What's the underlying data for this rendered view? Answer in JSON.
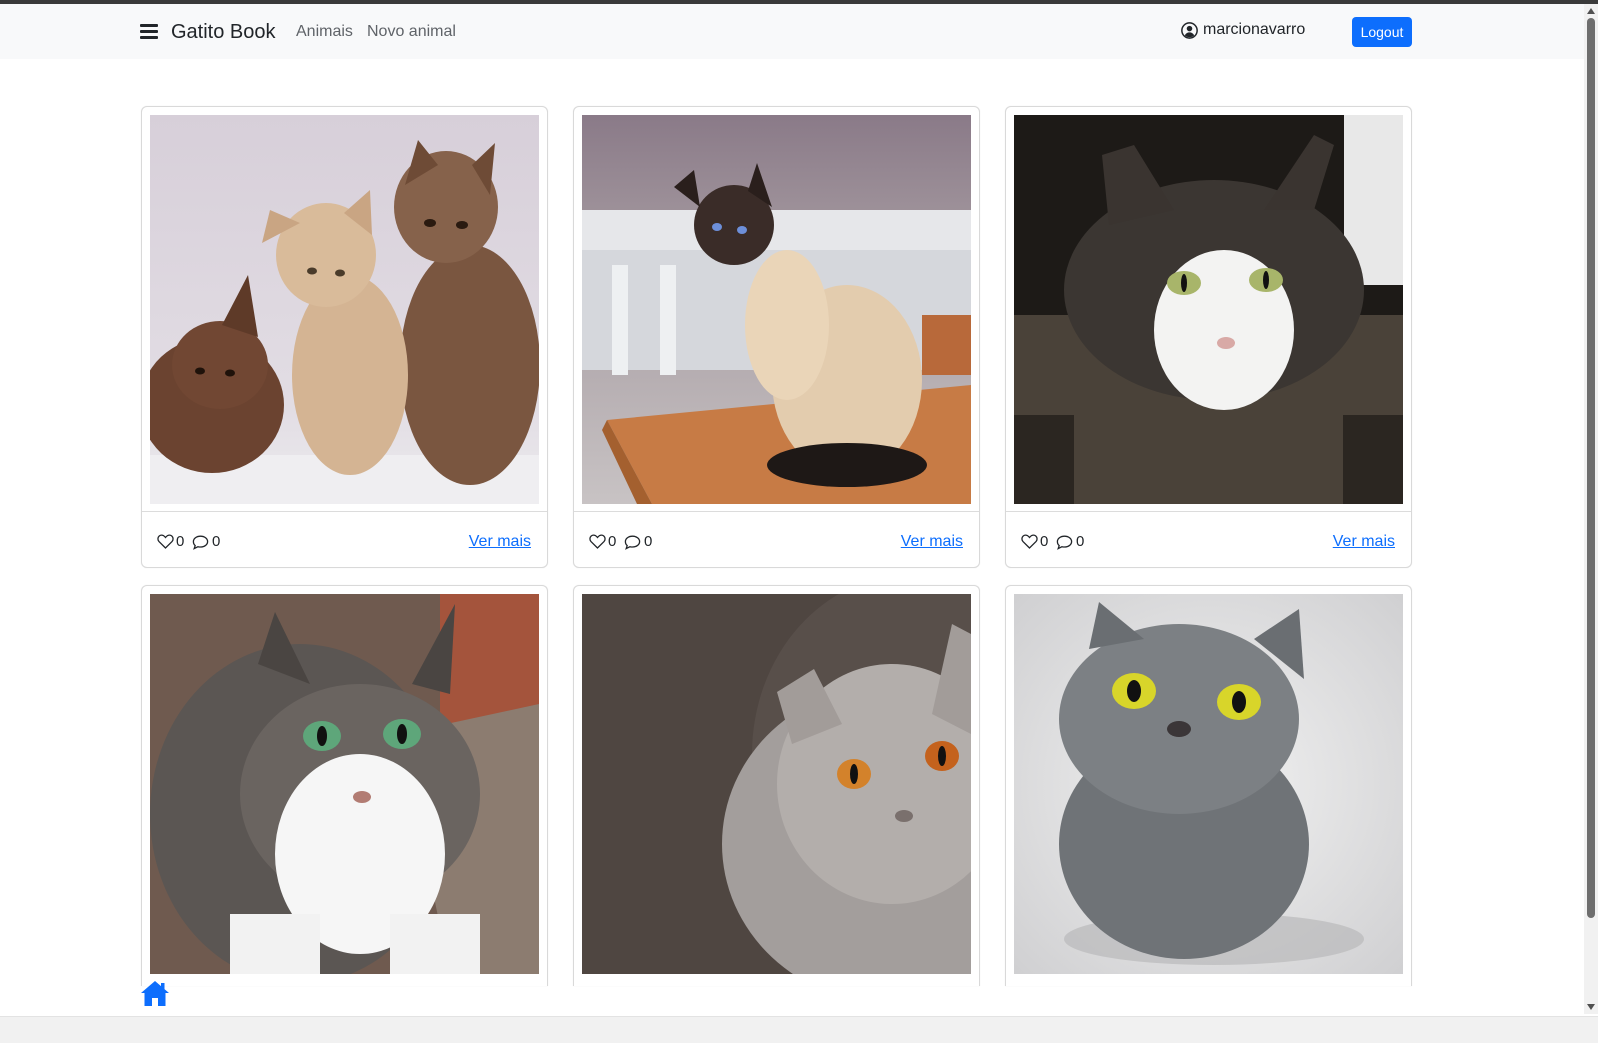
{
  "navbar": {
    "brand": "Gatito Book",
    "links": [
      "Animais",
      "Novo animal"
    ],
    "username": "marcionavarro",
    "logout_label": "Logout"
  },
  "icons": {
    "menu": "hamburger-menu-icon",
    "user": "user-circle-icon",
    "like": "heart-icon",
    "comment": "comment-icon",
    "home": "home-icon"
  },
  "colors": {
    "accent": "#0d6efd",
    "navbar_bg": "#f8f9fa"
  },
  "cards": [
    {
      "likes": "0",
      "comments": "0",
      "link": "Ver mais",
      "photo": "three-kittens-photo"
    },
    {
      "likes": "0",
      "comments": "0",
      "link": "Ver mais",
      "photo": "siamese-cat-photo"
    },
    {
      "likes": "0",
      "comments": "0",
      "link": "Ver mais",
      "photo": "black-white-cat-photo"
    },
    {
      "photo": "tabby-white-cat-photo"
    },
    {
      "photo": "british-shorthair-cat-photo"
    },
    {
      "photo": "grey-cat-looking-up-photo"
    }
  ]
}
